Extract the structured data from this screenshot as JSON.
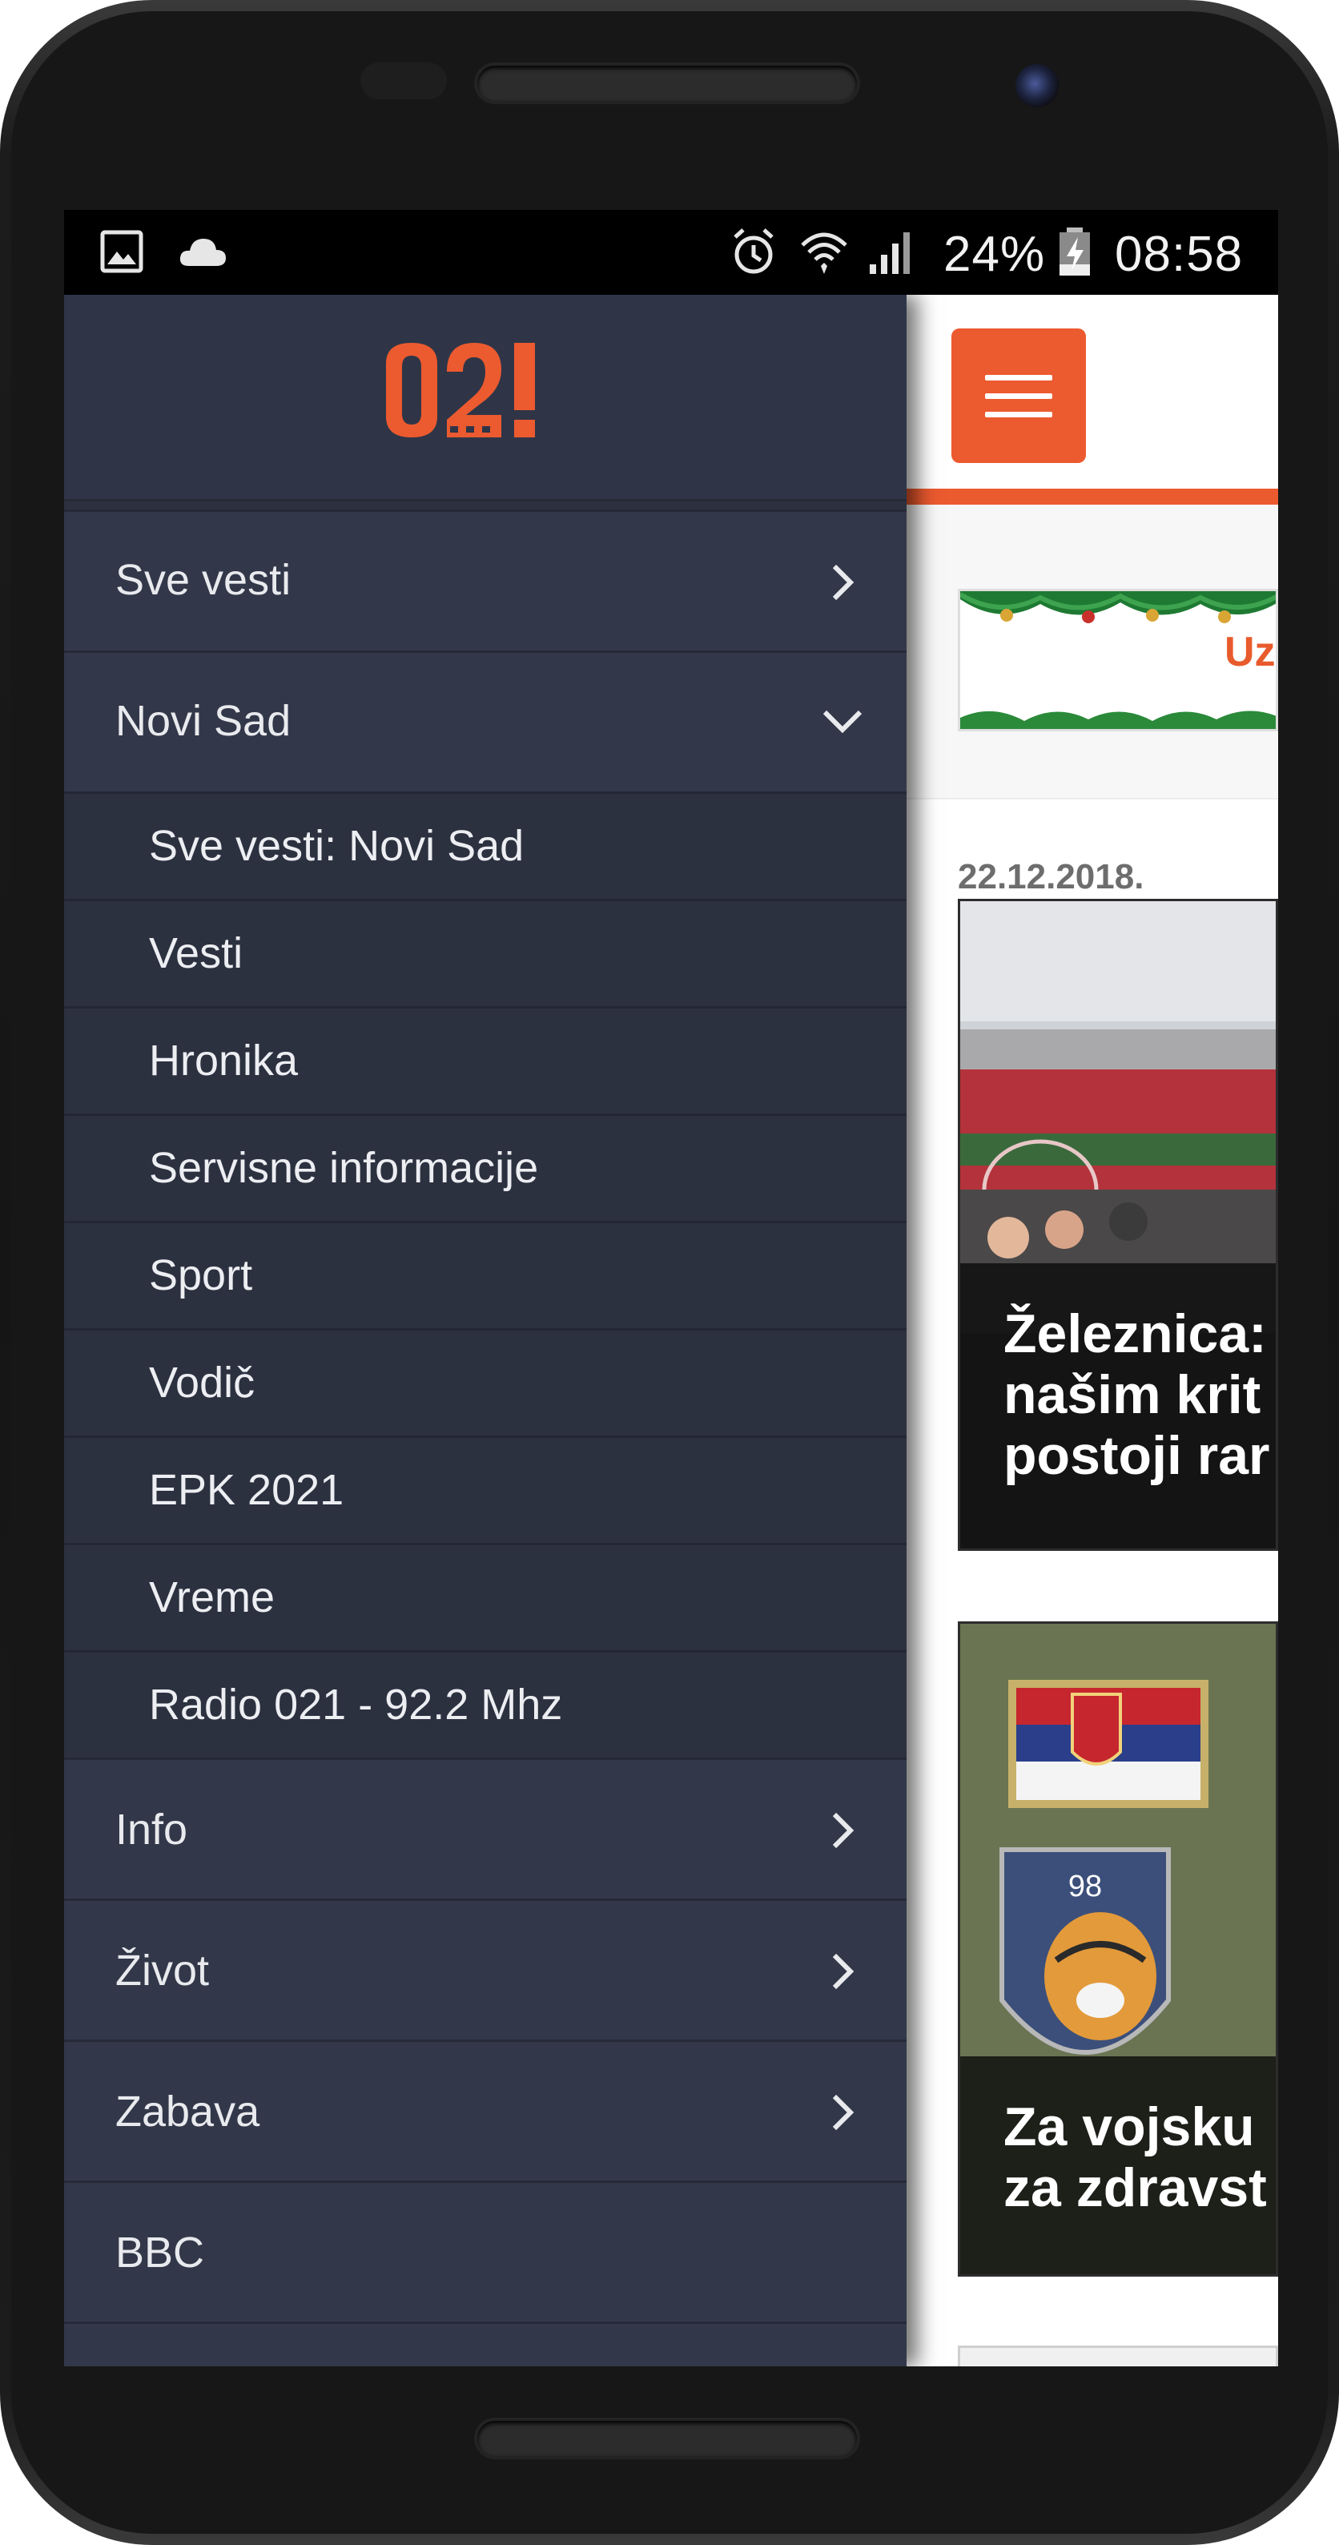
{
  "status_bar": {
    "battery": "24%",
    "time": "08:58"
  },
  "drawer": {
    "logo_text": "021",
    "items": [
      {
        "label": "Sve vesti",
        "chevron": "chevron-right"
      },
      {
        "label": "Novi Sad",
        "chevron": "chevron-down",
        "expanded": true,
        "subitems": [
          "Sve vesti: Novi Sad",
          "Vesti",
          "Hronika",
          "Servisne informacije",
          "Sport",
          "Vodič",
          "EPK 2021",
          "Vreme",
          "Radio 021 - 92.2 Mhz"
        ]
      },
      {
        "label": "Info",
        "chevron": "chevron-right"
      },
      {
        "label": "Život",
        "chevron": "chevron-right"
      },
      {
        "label": "Zabava",
        "chevron": "chevron-right"
      },
      {
        "label": "BBC"
      }
    ]
  },
  "content": {
    "ad_text": "Uz",
    "date": "22.12.2018.",
    "articles": [
      {
        "title_lines": [
          "Železnica:",
          "našim krit",
          "postoji rar"
        ]
      },
      {
        "title_lines": [
          "Za vojsku",
          "za zdravst"
        ]
      }
    ]
  },
  "colors": {
    "accent": "#ec5a2f",
    "drawer_bg": "#2c3140",
    "drawer_item_bg": "#323849"
  }
}
